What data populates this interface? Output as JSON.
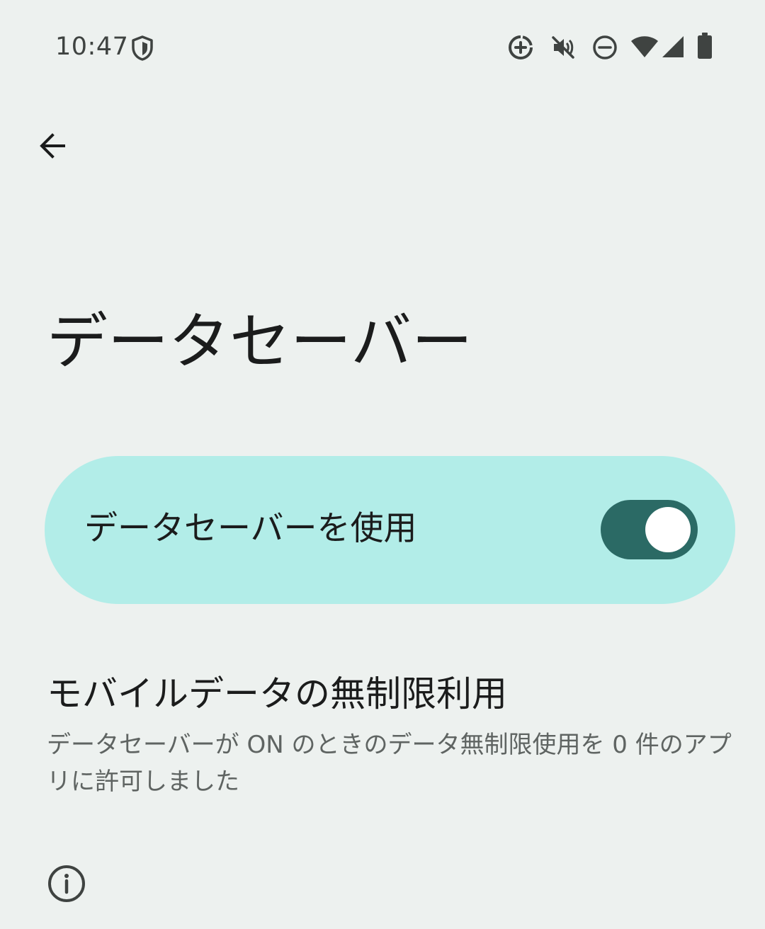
{
  "status_bar": {
    "time": "10:47",
    "left_icons": [
      "shield-icon"
    ],
    "right_icons": [
      "data-saver-icon",
      "vibrate-off-icon",
      "do-not-disturb-icon",
      "wifi-icon",
      "cellular-signal-icon",
      "battery-icon"
    ]
  },
  "toolbar": {
    "back_icon": "arrow-back-icon"
  },
  "page": {
    "title": "データセーバー"
  },
  "main_switch": {
    "label": "データセーバーを使用",
    "checked": true,
    "card_color": "#b2ede8",
    "track_color": "#2b6a65",
    "thumb_color": "#ffffff"
  },
  "unrestricted_data": {
    "title": "モバイルデータの無制限利用",
    "summary": "データセーバーが ON のときのデータ無制限使用を 0 件のアプリに許可しました"
  },
  "footer": {
    "info_icon": "info-icon"
  },
  "colors": {
    "background": "#edf1ef",
    "text_primary": "#1b1c1c",
    "text_secondary": "#5f6462"
  }
}
